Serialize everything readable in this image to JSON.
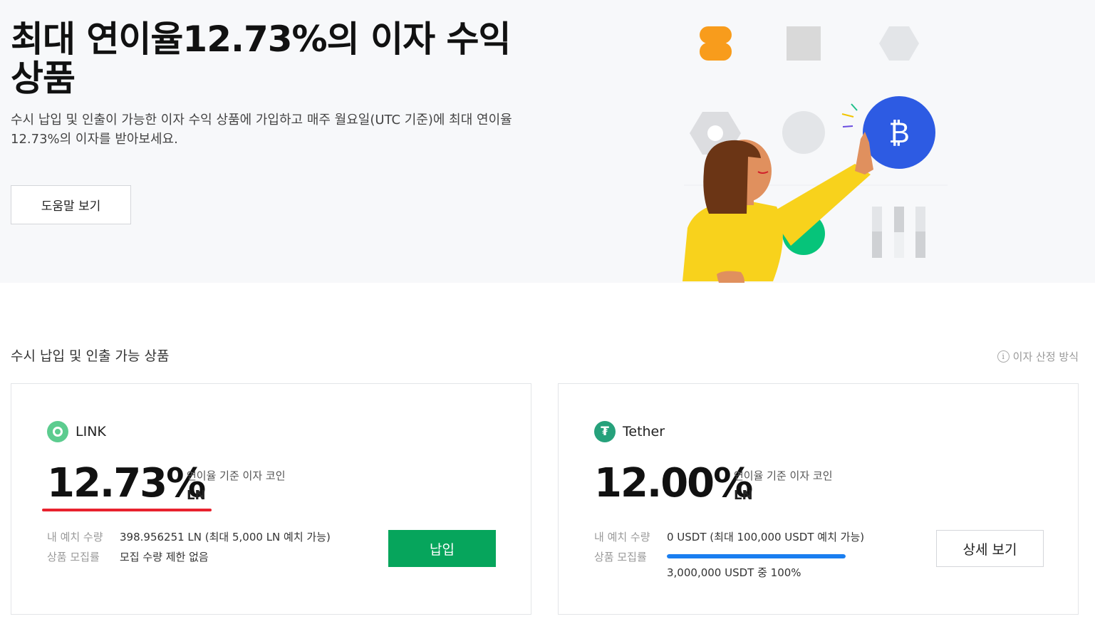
{
  "hero": {
    "title": "최대 연이율12.73%의 이자 수익 상품",
    "description": "수시 납입 및 인출이 가능한 이자 수익 상품에 가입하고 매주 월요일(UTC 기준)에 최대 연이율12.73%의 이자를 받아보세요.",
    "help_button": "도움말 보기"
  },
  "section": {
    "title": "수시 납입 및 인출 가능 상품",
    "calc_link": "이자 산정 방식",
    "info_icon": "i"
  },
  "products": [
    {
      "coin_name": "LINK",
      "coin_icon": "link-icon",
      "rate": "12.73%",
      "rate_label": "연이율 기준 이자 코인",
      "unit": "LN",
      "deposit_label": "내 예치 수량",
      "deposit_value": "398.956251 LN (최대 5,000 LN 예치 가능)",
      "recruit_label": "상품 모집률",
      "recruit_value": "모집 수량 제한 없음",
      "button": "납입",
      "accent": "#06a55c"
    },
    {
      "coin_name": "Tether",
      "coin_icon": "tether-icon",
      "coin_glyph": "₮",
      "rate": "12.00%",
      "rate_label": "연이율 기준 이자 코인",
      "unit": "LN",
      "deposit_label": "내 예치 수량",
      "deposit_value": "0 USDT (최대 100,000 USDT 예치 가능)",
      "recruit_label": "상품 모집률",
      "recruit_progress": 1.0,
      "recruit_value": "3,000,000 USDT 중 100%",
      "button": "상세 보기",
      "accent": "#26a17b"
    }
  ],
  "illustration": {
    "coin_symbol": "₿"
  },
  "colors": {
    "primary_green": "#06a55c",
    "progress_blue": "#1a7ef0",
    "highlight_red": "#e8222e",
    "bitcoin_blue": "#2d5be3"
  }
}
